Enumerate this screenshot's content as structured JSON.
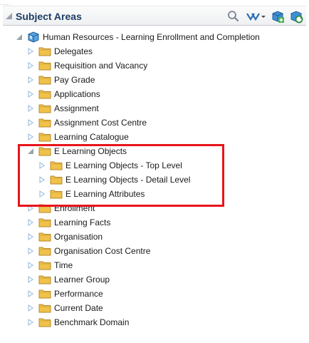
{
  "header": {
    "title": "Subject Areas",
    "icons": [
      "collapse-triangle-icon",
      "search-icon",
      "tree-filter-icon",
      "chevron-down-icon",
      "add-subject-area-icon",
      "refresh-icon"
    ]
  },
  "tree": {
    "root": {
      "label": "Human Resources - Learning Enrollment and Completion",
      "icon": "subject-area-cube-icon",
      "expanded": true
    },
    "items": [
      {
        "label": "Delegates",
        "expanded": false
      },
      {
        "label": "Requisition and Vacancy",
        "expanded": false
      },
      {
        "label": "Pay Grade",
        "expanded": false
      },
      {
        "label": "Applications",
        "expanded": false
      },
      {
        "label": "Assignment",
        "expanded": false
      },
      {
        "label": "Assignment Cost Centre",
        "expanded": false
      },
      {
        "label": "Learning Catalogue",
        "expanded": false
      },
      {
        "label": "E Learning Objects",
        "expanded": true,
        "children": [
          {
            "label": "E Learning Objects - Top Level",
            "expanded": false
          },
          {
            "label": "E Learning Objects - Detail Level",
            "expanded": false
          },
          {
            "label": "E Learning Attributes",
            "expanded": false
          }
        ]
      },
      {
        "label": "Enrollment",
        "expanded": false
      },
      {
        "label": "Learning Facts",
        "expanded": false
      },
      {
        "label": "Organisation",
        "expanded": false
      },
      {
        "label": "Organisation Cost Centre",
        "expanded": false
      },
      {
        "label": "Time",
        "expanded": false
      },
      {
        "label": "Learner Group",
        "expanded": false
      },
      {
        "label": "Performance",
        "expanded": false
      },
      {
        "label": "Current Date",
        "expanded": false
      },
      {
        "label": "Benchmark Domain",
        "expanded": false
      }
    ]
  },
  "colors": {
    "title": "#1d3c63",
    "highlight": "#e8141b",
    "folder": "#f2c94c",
    "expander": "#8fb4d9"
  }
}
